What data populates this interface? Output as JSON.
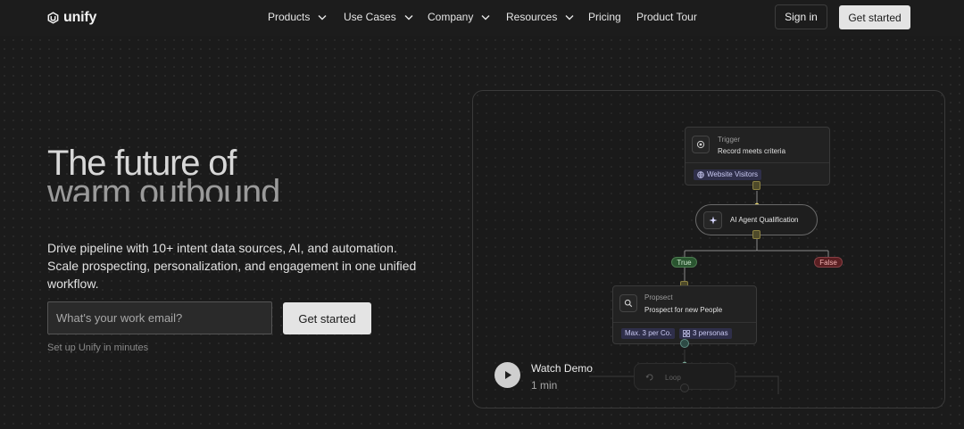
{
  "brand": {
    "name": "unify"
  },
  "nav": {
    "items": [
      {
        "label": "Products",
        "has_dropdown": true
      },
      {
        "label": "Use Cases",
        "has_dropdown": true
      },
      {
        "label": "Company",
        "has_dropdown": true
      },
      {
        "label": "Resources",
        "has_dropdown": true
      },
      {
        "label": "Pricing",
        "has_dropdown": false
      },
      {
        "label": "Product Tour",
        "has_dropdown": false
      }
    ],
    "sign_in": "Sign in",
    "get_started": "Get started"
  },
  "hero": {
    "headline_line1": "The future of",
    "headline_line2": "warm outbound",
    "subtext": "Drive pipeline with 10+ intent data sources, AI, and automation. Scale prospecting, personalization, and engagement in one unified workflow.",
    "email_placeholder": "What's your work email?",
    "cta": "Get started",
    "setup_note": "Set up Unify in minutes"
  },
  "workflow": {
    "trigger": {
      "kicker": "Trigger",
      "title": "Record meets criteria",
      "tag": "Website Visitors"
    },
    "agent": {
      "title": "AI Agent Qualification"
    },
    "branch_true": "True",
    "branch_false": "False",
    "prospect": {
      "kicker": "Propsect",
      "title": "Prospect for new People",
      "tag1": "Max. 3 per Co.",
      "tag2": "3 personas"
    },
    "loop": {
      "title": "Loop"
    }
  },
  "demo": {
    "title": "Watch Demo",
    "duration": "1 min"
  },
  "colors": {
    "background": "#1b1b1b",
    "button_light": "#e4e4e4",
    "true_green": "#2a5530",
    "false_red": "#5a1f22",
    "tag_purple": "#2f2f4a"
  }
}
